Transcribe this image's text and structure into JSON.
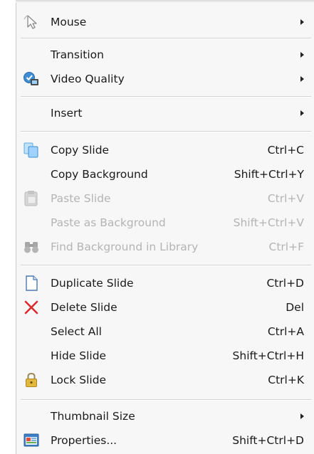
{
  "menu": {
    "mouse": {
      "label": "Mouse"
    },
    "transition": {
      "label": "Transition"
    },
    "video_quality": {
      "label": "Video Quality"
    },
    "insert": {
      "label": "Insert"
    },
    "copy_slide": {
      "label": "Copy Slide",
      "shortcut": "Ctrl+C"
    },
    "copy_background": {
      "label": "Copy Background",
      "shortcut": "Shift+Ctrl+Y"
    },
    "paste_slide": {
      "label": "Paste Slide",
      "shortcut": "Ctrl+V",
      "enabled": false
    },
    "paste_background": {
      "label": "Paste as Background",
      "shortcut": "Shift+Ctrl+V",
      "enabled": false
    },
    "find_background": {
      "label": "Find Background in Library",
      "shortcut": "Ctrl+F",
      "enabled": false
    },
    "duplicate_slide": {
      "label": "Duplicate Slide",
      "shortcut": "Ctrl+D"
    },
    "delete_slide": {
      "label": "Delete Slide",
      "shortcut": "Del"
    },
    "select_all": {
      "label": "Select All",
      "shortcut": "Ctrl+A"
    },
    "hide_slide": {
      "label": "Hide Slide",
      "shortcut": "Shift+Ctrl+H"
    },
    "lock_slide": {
      "label": "Lock Slide",
      "shortcut": "Ctrl+K"
    },
    "thumbnail_size": {
      "label": "Thumbnail Size"
    },
    "properties": {
      "label": "Properties...",
      "shortcut": "Shift+Ctrl+D"
    }
  },
  "icons": {
    "mouse": "mouse-pointer-icon",
    "video_quality": "video-quality-icon",
    "copy_slide": "copy-icon",
    "paste_slide": "paste-icon",
    "find_background": "binoculars-icon",
    "duplicate_slide": "document-icon",
    "delete_slide": "red-x-icon",
    "lock_slide": "padlock-icon",
    "properties": "properties-icon"
  }
}
